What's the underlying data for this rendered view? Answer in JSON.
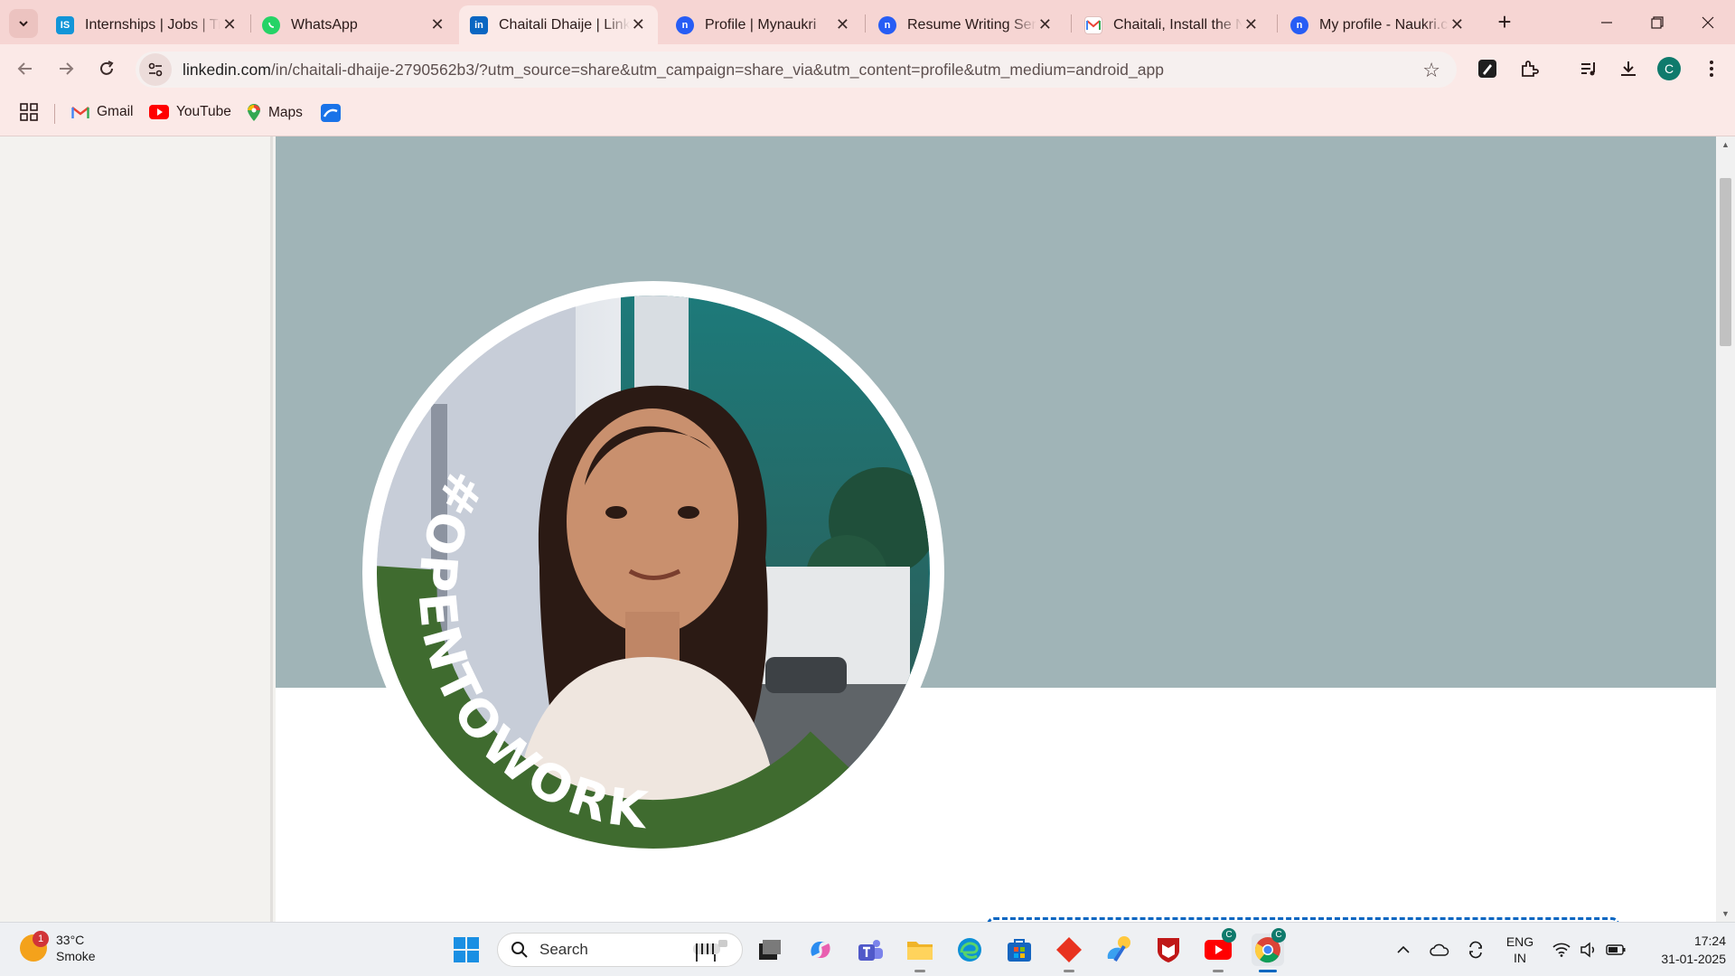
{
  "browser": {
    "tabs": [
      {
        "title": "Internships | Jobs | Training",
        "favicon": "internshala-icon",
        "color": "#1295d8",
        "active": false
      },
      {
        "title": "WhatsApp",
        "favicon": "whatsapp-icon",
        "color": "#25d366",
        "active": false
      },
      {
        "title": "Chaitali Dhaije | LinkedIn",
        "favicon": "linkedin-icon",
        "color": "#0a66c2",
        "active": true
      },
      {
        "title": "Profile | Mynaukri",
        "favicon": "naukri-icon",
        "color": "#275df5",
        "active": false
      },
      {
        "title": "Resume Writing Services",
        "favicon": "naukri-icon",
        "color": "#275df5",
        "active": false
      },
      {
        "title": "Chaitali, Install the Naukri app",
        "favicon": "gmail-icon",
        "color": "#ea4335",
        "active": false
      },
      {
        "title": "My profile - Naukri.com",
        "favicon": "naukri-icon",
        "color": "#275df5",
        "active": false
      }
    ],
    "url_host": "linkedin.com",
    "url_rest": "/in/chaitali-dhaije-2790562b3/?utm_source=share&utm_campaign=share_via&utm_content=profile&utm_medium=android_app",
    "profile_initial": "C",
    "bookmarks": [
      {
        "label": "Gmail",
        "icon": "gmail-icon"
      },
      {
        "label": "YouTube",
        "icon": "youtube-icon"
      },
      {
        "label": "Maps",
        "icon": "maps-icon"
      }
    ]
  },
  "profile": {
    "cover_color": "#a0b4b7",
    "frame_text": "#OPENTOWORK",
    "frame_color": "#3f6b2f"
  },
  "taskbar": {
    "weather_temp": "33°C",
    "weather_desc": "Smoke",
    "weather_badge": "1",
    "search_placeholder": "Search",
    "lang_top": "ENG",
    "lang_bottom": "IN",
    "time": "17:24",
    "date": "31-01-2025"
  }
}
